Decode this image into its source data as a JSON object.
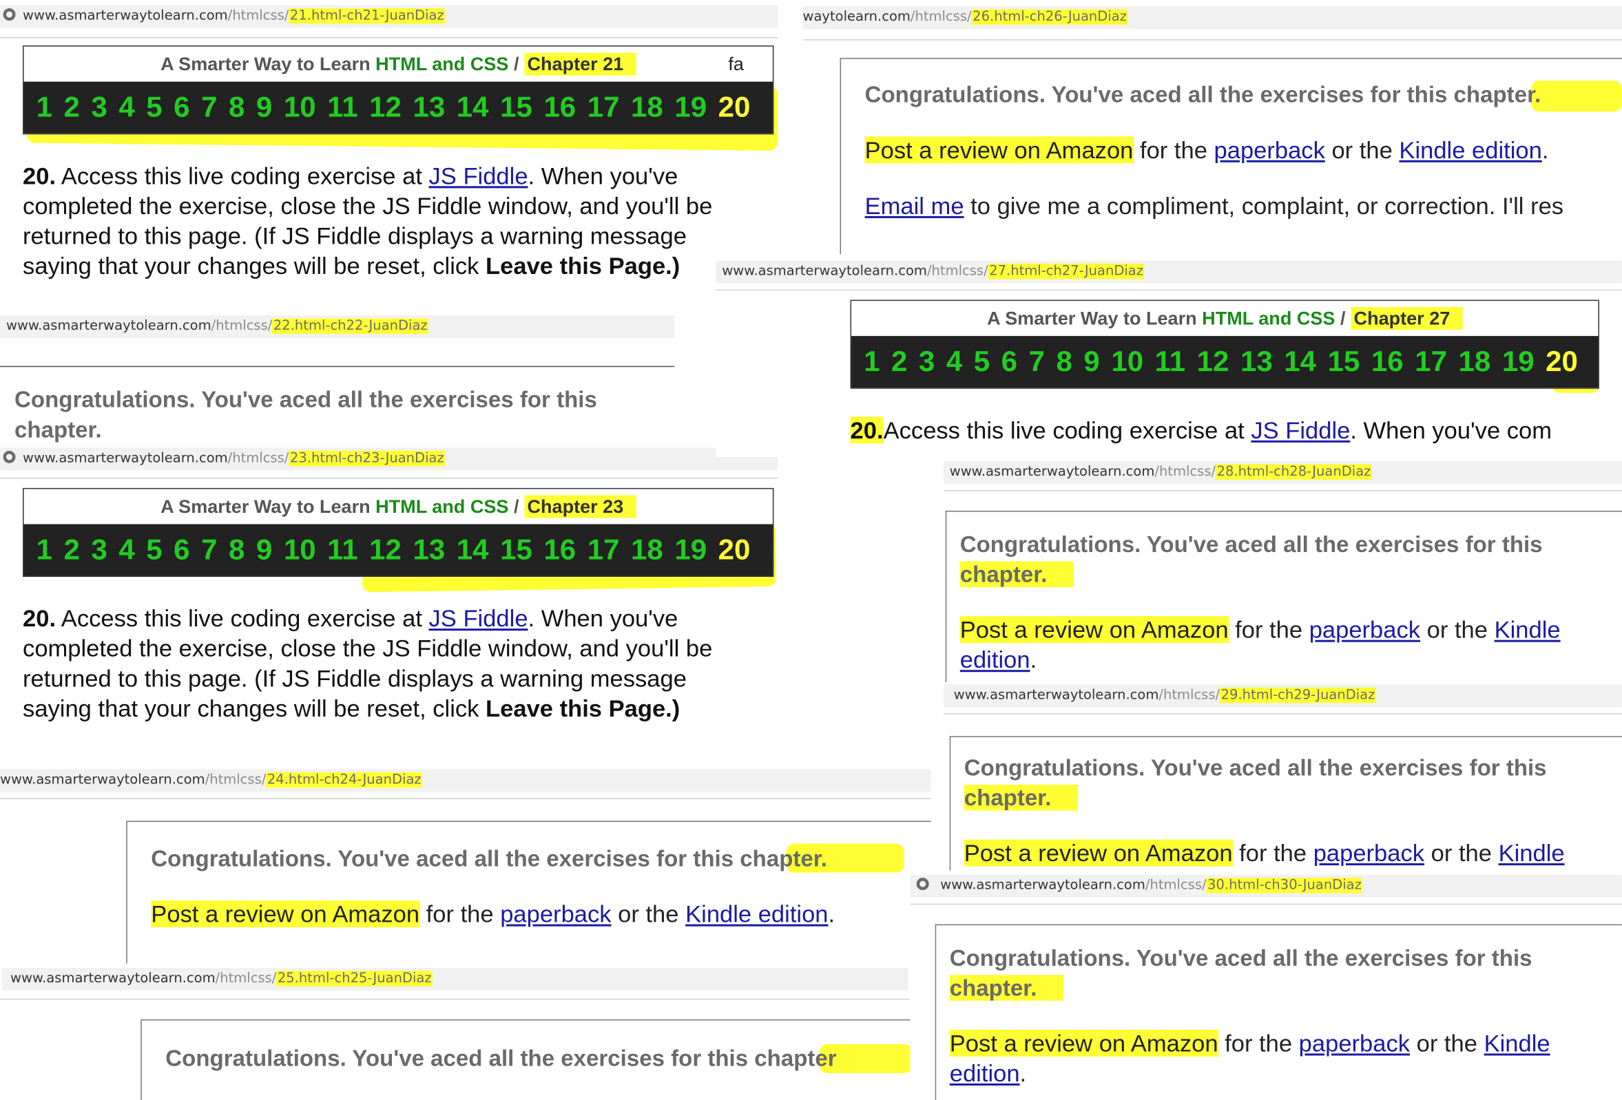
{
  "address_bar": {
    "domain": "www.asmarterwaytolearn.com",
    "domain_partial": "waytolearn.com",
    "path": "/htmlcss/",
    "pages": [
      {
        "slug": "21.html-ch21-JuanDiaz"
      },
      {
        "slug": "26.html-ch26-JuanDiaz"
      },
      {
        "slug": "27.html-ch27-JuanDiaz"
      },
      {
        "slug": "22.html-ch22-JuanDiaz"
      },
      {
        "slug": "23.html-ch23-JuanDiaz"
      },
      {
        "slug": "28.html-ch28-JuanDiaz"
      },
      {
        "slug": "29.html-ch29-JuanDiaz"
      },
      {
        "slug": "24.html-ch24-JuanDiaz"
      },
      {
        "slug": "30.html-ch30-JuanDiaz"
      },
      {
        "slug": "25.html-ch25-JuanDiaz"
      }
    ]
  },
  "chapter_header": {
    "site_prefix": "A Smarter Way to Learn",
    "site_subject": "HTML and CSS",
    "separator": "/",
    "chapter_labels": [
      "Chapter 21",
      "Chapter 23",
      "Chapter 27"
    ],
    "stray_text": "fa",
    "exercise_numbers": [
      "1",
      "2",
      "3",
      "4",
      "5",
      "6",
      "7",
      "8",
      "9",
      "10",
      "11",
      "12",
      "13",
      "14",
      "15",
      "16",
      "17",
      "18",
      "19",
      "20"
    ],
    "current_exercise": "20"
  },
  "exercise": {
    "number": "20.",
    "intro": "Access this live coding exercise at",
    "link": "JS Fiddle",
    "after_link": ". When you've completed the exercise, close the JS Fiddle window, and you'll be returned to this page. (If JS Fiddle displays a warning message saying that your changes will be reset, click",
    "leave_label": "Leave this Page.)",
    "truncated_tail": ". When you've com",
    "truncated_first": "A"
  },
  "congrats": {
    "title": "Congratulations. You've aced all the exercises for this chapter.",
    "title_part1": "Congratulations. You've aced all the exercises for this",
    "title_part2": "chapter.",
    "title_part1_ch26": "Congratulations. You've aced all the exercises for this ch",
    "title_part2_ch26": "apter.",
    "title_part1_ch24": "Congratulations. You've aced all the exercises for thi",
    "title_part2_ch24": "s chapter.",
    "title_part1_ch25": "Congratulations. You've aced all the exercises for this c",
    "title_part2_ch25": "hapter",
    "review_link": "Post a review on Amazon",
    "for_the": "for the",
    "paperback": "paperback",
    "or_the": "or the",
    "kindle": "Kindle",
    "edition": "edition",
    "kindle_edition": "Kindle edition",
    "period": ".",
    "email_link": "Email me",
    "email_text": "to give me a compliment, complaint, or correction. I'll res"
  },
  "colors": {
    "highlight": "#ffff33",
    "number_green": "#22cc22",
    "subject_green": "#1a8a1a",
    "dark_bar": "#222222",
    "link_blue": "#1a1aa6"
  }
}
